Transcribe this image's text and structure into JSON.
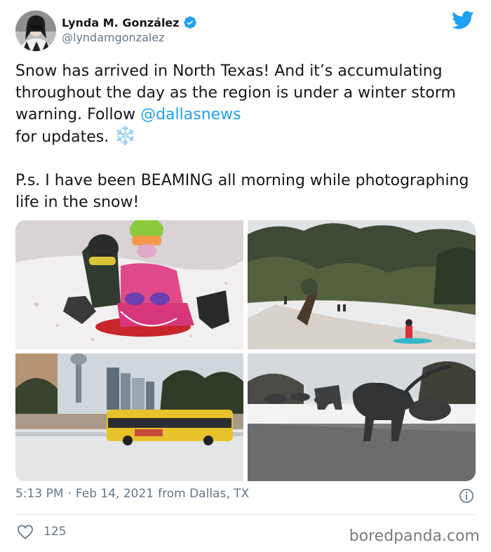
{
  "author": {
    "display_name": "Lynda M. González",
    "handle": "@lyndamgonzalez",
    "verified": true,
    "avatar_icon": "user-avatar"
  },
  "tweet": {
    "text_part1": "Snow has arrived in North Texas! And it’s accumulating throughout the day as the region is under a winter storm warning. Follow ",
    "mention": "@dallasnews",
    "text_part2": "\n for updates. ",
    "emoji": "❄️",
    "text_part3": "\n\nP.s. I have been BEAMING all morning while photographing life in the snow!"
  },
  "media": [
    {
      "icon": "photo-children-sledding"
    },
    {
      "icon": "photo-snowy-park-hill"
    },
    {
      "icon": "photo-yellow-bus-in-snow"
    },
    {
      "icon": "photo-longhorn-sculptures"
    }
  ],
  "meta": {
    "time": "5:13 PM",
    "separator": "·",
    "date": "Feb 14, 2021",
    "location": "from Dallas, TX"
  },
  "engagement": {
    "likes": "125"
  },
  "watermark": "boredpanda.com",
  "colors": {
    "brand_blue": "#1da1f2",
    "text": "#14171a",
    "muted": "#657786"
  }
}
